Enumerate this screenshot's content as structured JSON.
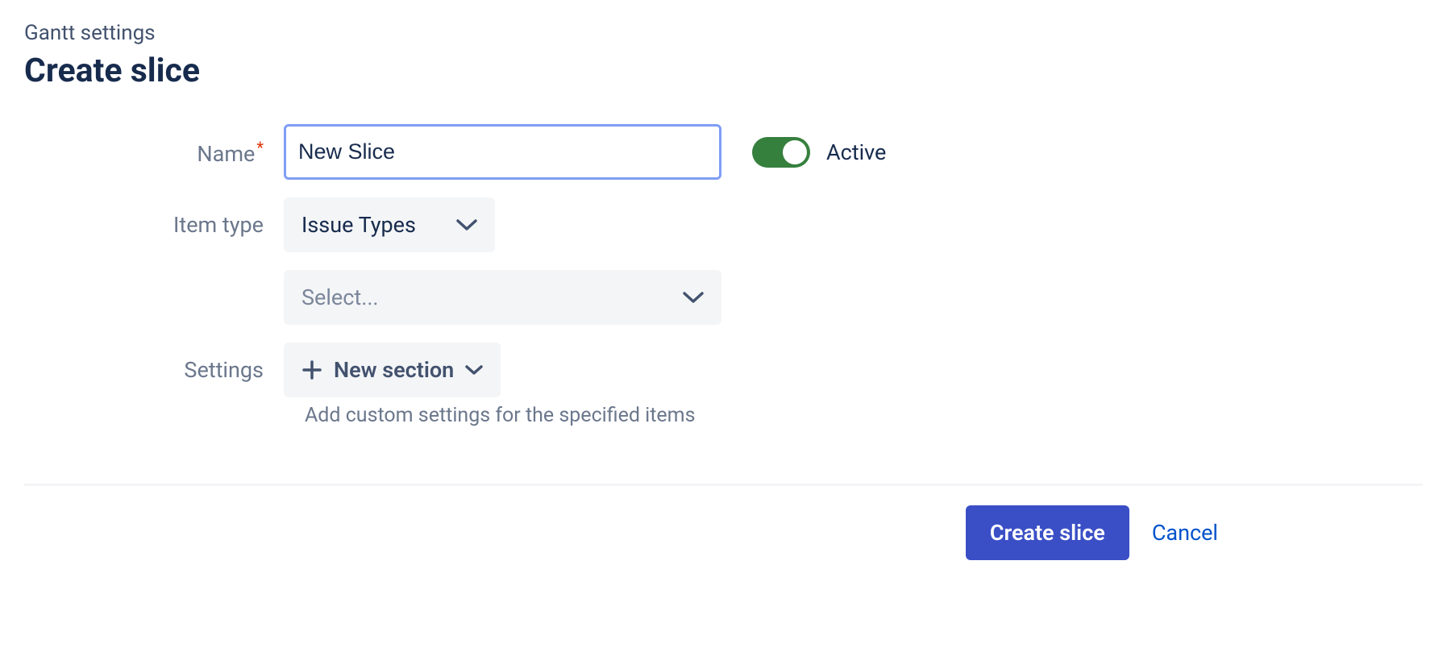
{
  "breadcrumb": "Gantt settings",
  "title": "Create slice",
  "form": {
    "name": {
      "label": "Name",
      "value": "New Slice"
    },
    "active": {
      "label": "Active",
      "value": true
    },
    "item_type": {
      "label": "Item type",
      "selected": "Issue Types",
      "sub_select_placeholder": "Select..."
    },
    "settings": {
      "label": "Settings",
      "new_section_label": "New section",
      "help": "Add custom settings for the specified items"
    }
  },
  "footer": {
    "create": "Create slice",
    "cancel": "Cancel"
  }
}
